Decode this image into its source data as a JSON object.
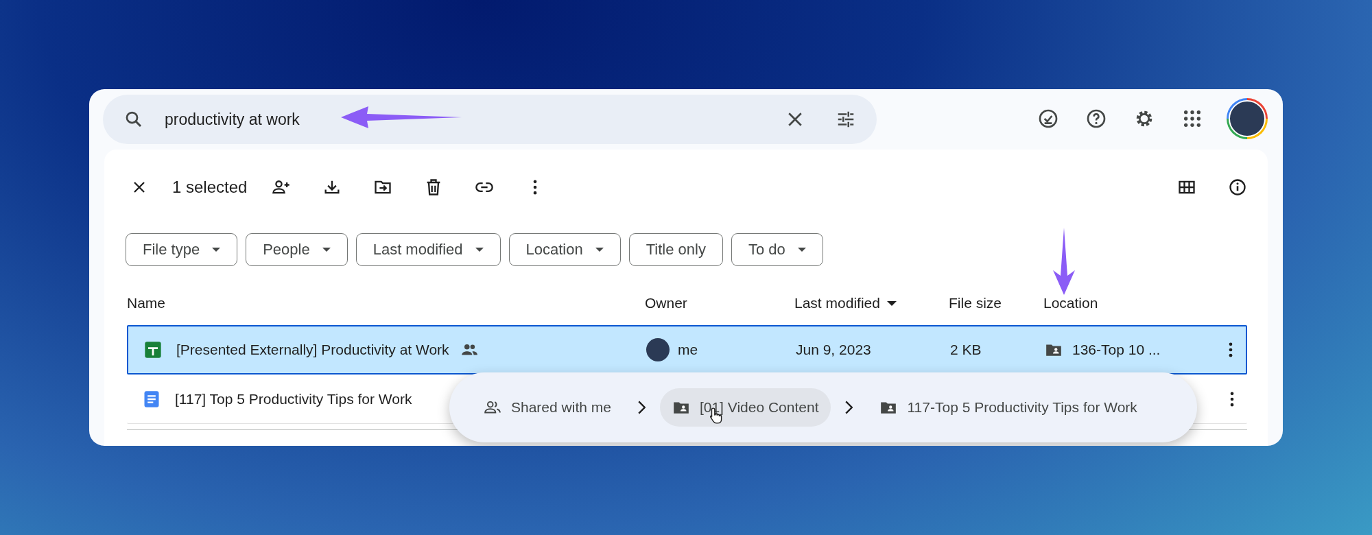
{
  "search": {
    "value": "productivity at work"
  },
  "selection": {
    "count_label": "1 selected"
  },
  "filters": [
    {
      "label": "File type",
      "dropdown": true
    },
    {
      "label": "People",
      "dropdown": true
    },
    {
      "label": "Last modified",
      "dropdown": true
    },
    {
      "label": "Location",
      "dropdown": true
    },
    {
      "label": "Title only",
      "dropdown": false
    },
    {
      "label": "To do",
      "dropdown": true
    }
  ],
  "table": {
    "columns": [
      {
        "label": "Name",
        "sorted": false
      },
      {
        "label": "Owner",
        "sorted": false
      },
      {
        "label": "Last modified",
        "sorted": true
      },
      {
        "label": "File size",
        "sorted": false
      },
      {
        "label": "Location",
        "sorted": false
      }
    ],
    "rows": [
      {
        "kind": "sheet",
        "name": "[Presented Externally] Productivity at Work",
        "shared": true,
        "owner": "me",
        "modified": "Jun 9, 2023",
        "size": "2 KB",
        "location": "136-Top 10 ...",
        "selected": true
      },
      {
        "kind": "doc",
        "name": "[117] Top 5 Productivity Tips for Work",
        "shared": false,
        "selected": false
      }
    ]
  },
  "location_popup": {
    "items": [
      {
        "kind": "shared",
        "label": "Shared with me",
        "highlighted": false
      },
      {
        "kind": "folder",
        "label": "[01] Video Content",
        "highlighted": true
      },
      {
        "kind": "folder",
        "label": "117-Top 5 Productivity Tips for Work",
        "highlighted": false
      }
    ]
  }
}
